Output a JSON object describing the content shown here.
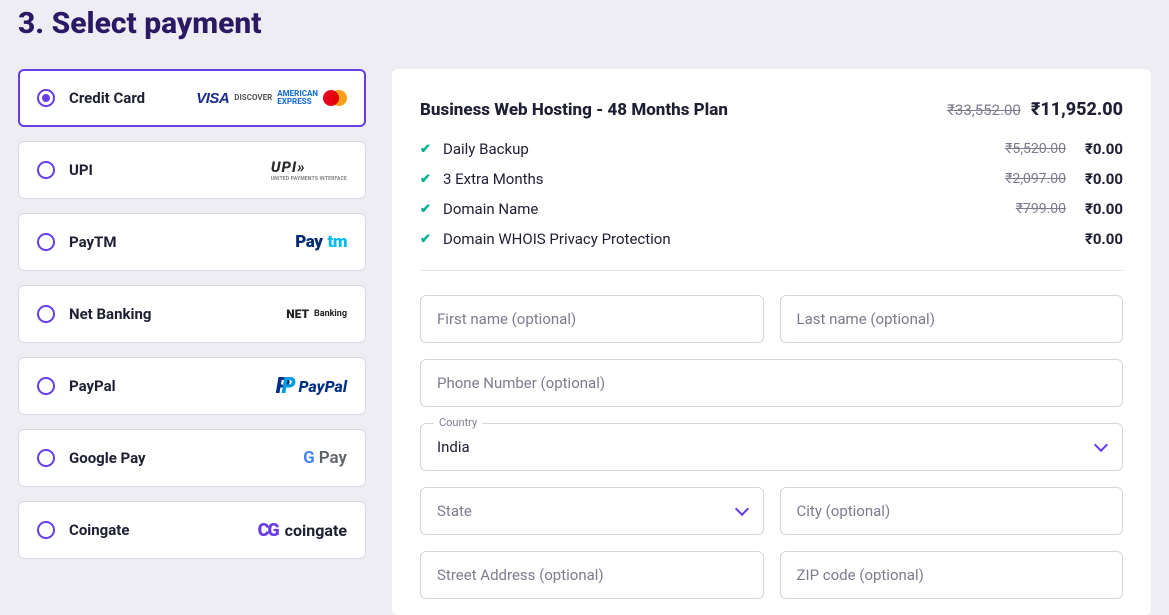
{
  "heading": "3. Select payment",
  "payment_methods": [
    {
      "label": "Credit Card",
      "selected": true,
      "logo": "cards"
    },
    {
      "label": "UPI",
      "selected": false,
      "logo": "upi"
    },
    {
      "label": "PayTM",
      "selected": false,
      "logo": "paytm"
    },
    {
      "label": "Net Banking",
      "selected": false,
      "logo": "netbanking"
    },
    {
      "label": "PayPal",
      "selected": false,
      "logo": "paypal"
    },
    {
      "label": "Google Pay",
      "selected": false,
      "logo": "gpay"
    },
    {
      "label": "Coingate",
      "selected": false,
      "logo": "coingate"
    }
  ],
  "summary": {
    "plan_name": "Business Web Hosting - 48 Months Plan",
    "original_price": "₹33,552.00",
    "price": "₹11,952.00",
    "items": [
      {
        "name": "Daily Backup",
        "original": "₹5,520.00",
        "price": "₹0.00"
      },
      {
        "name": "3 Extra Months",
        "original": "₹2,097.00",
        "price": "₹0.00"
      },
      {
        "name": "Domain Name",
        "original": "₹799.00",
        "price": "₹0.00"
      },
      {
        "name": "Domain WHOIS Privacy Protection",
        "original": "",
        "price": "₹0.00"
      }
    ]
  },
  "form": {
    "first_name_ph": "First name (optional)",
    "last_name_ph": "Last name (optional)",
    "phone_ph": "Phone Number (optional)",
    "country_label": "Country",
    "country_value": "India",
    "state_ph": "State",
    "city_ph": "City (optional)",
    "street_ph": "Street Address (optional)",
    "zip_ph": "ZIP code (optional)"
  },
  "logos": {
    "visa": "VISA",
    "discover": "DISCOVER",
    "amex_l1": "AMERICAN",
    "amex_l2": "EXPRESS",
    "upi": "UPI",
    "upi_sub": "UNITED PAYMENTS INTERFACE",
    "paytm_p1": "Pay",
    "paytm_p2": "tm",
    "nb_l1": "NET",
    "nb_l2": "Banking",
    "paypal": "PayPal",
    "gpay": "Pay",
    "coingate": "coingate"
  }
}
